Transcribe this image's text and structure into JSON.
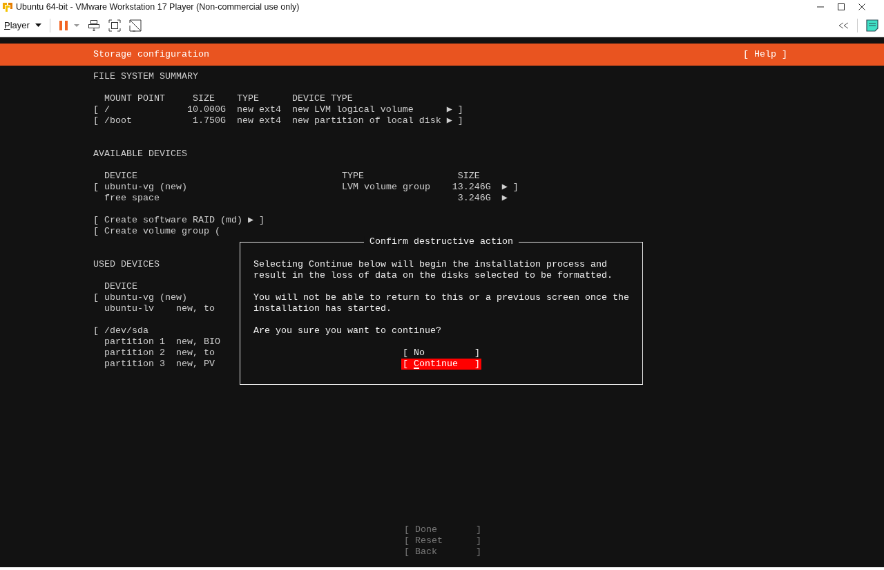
{
  "window": {
    "title": "Ubuntu 64-bit - VMware Workstation 17 Player (Non-commercial use only)"
  },
  "toolbar": {
    "menu": "Player"
  },
  "screen": {
    "header": {
      "title": "Storage configuration",
      "help": {
        "open": "[",
        "label": "Help",
        "close": "]"
      }
    },
    "file_system_summary": {
      "heading": "FILE SYSTEM SUMMARY",
      "columns": [
        "MOUNT POINT",
        "SIZE",
        "TYPE",
        "DEVICE TYPE"
      ],
      "rows": [
        {
          "open": "[",
          "mount_point": "/",
          "size": "10.000G",
          "type": "new ext4",
          "device_type": "new LVM logical volume",
          "arrow": "▶",
          "close": "]"
        },
        {
          "open": "[",
          "mount_point": "/boot",
          "size": "1.750G",
          "type": "new ext4",
          "device_type": "new partition of local disk",
          "arrow": "▶",
          "close": "]"
        }
      ]
    },
    "available_devices": {
      "heading": "AVAILABLE DEVICES",
      "columns": [
        "DEVICE",
        "TYPE",
        "SIZE"
      ],
      "rows": [
        {
          "open": "[",
          "device": "ubuntu-vg (new)",
          "type": "LVM volume group",
          "size": "13.246G",
          "arrow": "▶",
          "close": "]"
        },
        {
          "device": "free space",
          "size": "3.246G",
          "arrow": "▶"
        }
      ]
    },
    "actions": [
      {
        "open": "[",
        "label": "Create software RAID (md)",
        "arrow": "▶",
        "close": "]"
      },
      {
        "open": "[",
        "label": "Create volume group ("
      }
    ],
    "used_devices": {
      "heading": "USED DEVICES",
      "columns": [
        "DEVICE"
      ],
      "groups": [
        {
          "rows": [
            {
              "open": "[",
              "device": "ubuntu-vg (new)"
            },
            {
              "device": "ubuntu-lv",
              "detail": "new, to"
            }
          ]
        },
        {
          "rows": [
            {
              "open": "[",
              "device": "/dev/sda"
            },
            {
              "device": "partition 1",
              "detail": "new, BIO"
            },
            {
              "device": "partition 2",
              "detail": "new, to"
            },
            {
              "device": "partition 3",
              "detail": "new, PV"
            }
          ]
        }
      ]
    },
    "footer_buttons": [
      {
        "open": "[",
        "label": "Done",
        "close": "]"
      },
      {
        "open": "[",
        "label": "Reset",
        "close": "]"
      },
      {
        "open": "[",
        "label": "Back",
        "close": "]"
      }
    ]
  },
  "dialog": {
    "title": "Confirm destructive action",
    "paragraphs": [
      "Selecting Continue below will begin the installation process and result in the loss of data on the disks selected to be formatted.",
      "You will not be able to return to this or a previous screen once the installation has started.",
      "Are you sure you want to continue?"
    ],
    "buttons": [
      {
        "open": "[",
        "label": "No",
        "close": "]",
        "selected": false
      },
      {
        "open": "[",
        "label": "Continue",
        "close": "]",
        "selected": true
      }
    ]
  }
}
